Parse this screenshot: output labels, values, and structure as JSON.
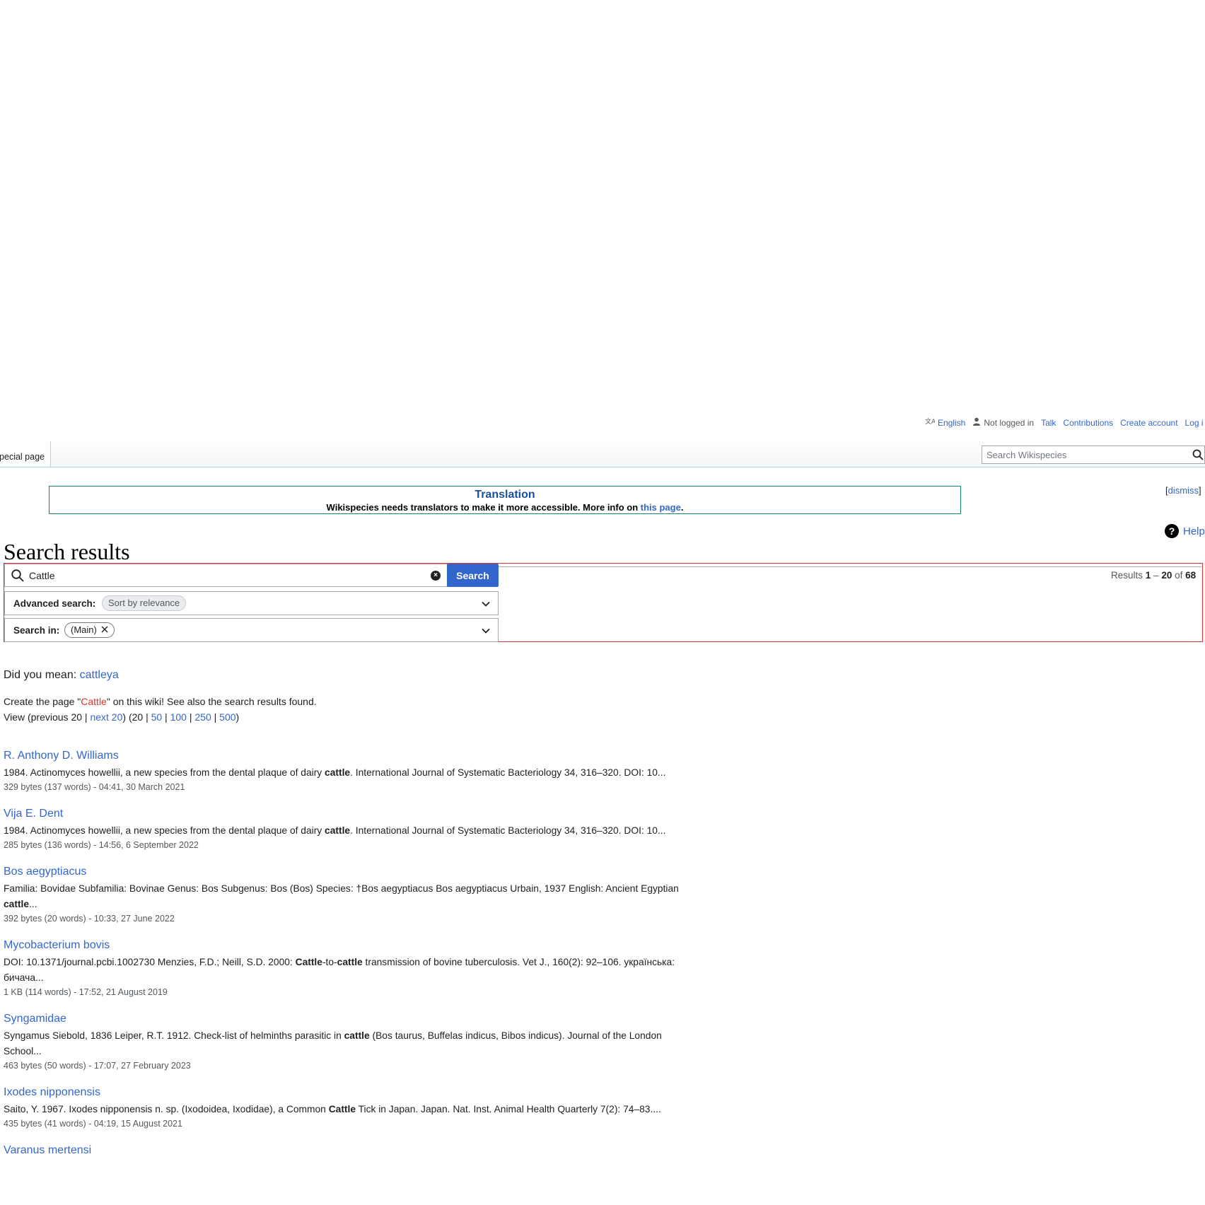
{
  "personal": {
    "language": "English",
    "not_logged_in": "Not logged in",
    "talk": "Talk",
    "contributions": "Contributions",
    "create_account": "Create account",
    "log_in": "Log i"
  },
  "tabs": {
    "special_page": "pecial page"
  },
  "header_search": {
    "placeholder": "Search Wikispecies"
  },
  "banner": {
    "title": "Translation",
    "text_prefix": "Wikispecies needs translators to make it more accessible. More info on ",
    "link": "this page",
    "text_suffix": "."
  },
  "dismiss": {
    "open": "[",
    "label": "dismiss",
    "close": "]"
  },
  "page": {
    "title": "Search results",
    "help": "Help"
  },
  "search_form": {
    "value": "Cattle",
    "button": "Search",
    "results_prefix": "Results ",
    "results_range_start": "1",
    "results_dash": " – ",
    "results_range_end": "20",
    "results_of": " of ",
    "results_total": "68",
    "advanced_label": "Advanced search:",
    "advanced_chip": "Sort by relevance",
    "search_in_label": "Search in:",
    "search_in_chip": "(Main)"
  },
  "did_you_mean": {
    "prefix": "Did you mean: ",
    "suggestion": "cattleya"
  },
  "create": {
    "prefix": "Create the page \"",
    "page": "Cattle",
    "suffix": "\" on this wiki! See also the search results found."
  },
  "view": {
    "prefix": "View (previous 20 | ",
    "next": "next 20",
    "mid": ") (20 | ",
    "n50": "50",
    "n100": "100",
    "n250": "250",
    "n500": "500",
    "sep": " | ",
    "end": ")"
  },
  "results": [
    {
      "title": "R. Anthony D. Williams",
      "snippet_before": "1984. Actinomyces howellii, a new species from the dental plaque of dairy ",
      "snippet_bold": "cattle",
      "snippet_after": ". International Journal of Systematic Bacteriology 34, 316–320. DOI: 10...",
      "meta": "329 bytes (137 words) - 04:41, 30 March 2021"
    },
    {
      "title": "Vija E. Dent",
      "snippet_before": "1984. Actinomyces howellii, a new species from the dental plaque of dairy ",
      "snippet_bold": "cattle",
      "snippet_after": ". International Journal of Systematic Bacteriology 34, 316–320. DOI: 10...",
      "meta": "285 bytes (136 words) - 14:56, 6 September 2022"
    },
    {
      "title": "Bos aegyptiacus",
      "snippet_before": "Familia: Bovidae Subfamilia: Bovinae Genus: Bos Subgenus: Bos (Bos) Species: †Bos aegyptiacus Bos aegyptiacus Urbain, 1937 English: Ancient Egyptian ",
      "snippet_bold": "cattle",
      "snippet_after": "...",
      "meta": "392 bytes (20 words) - 10:33, 27 June 2022"
    },
    {
      "title": "Mycobacterium bovis",
      "snippet_before": "DOI: 10.1371/journal.pcbi.1002730 Menzies, F.D.; Neill, S.D. 2000: ",
      "snippet_bold": "Cattle",
      "snippet_mid": "-to-",
      "snippet_bold2": "cattle",
      "snippet_after": " transmission of bovine tuberculosis. Vet J., 160(2): 92–106. українська: бичача...",
      "meta": "1 KB (114 words) - 17:52, 21 August 2019"
    },
    {
      "title": "Syngamidae",
      "snippet_before": "Syngamus Siebold, 1836 Leiper, R.T. 1912. Check-list of helminths parasitic in ",
      "snippet_bold": "cattle",
      "snippet_after": " (Bos taurus, Buffelas indicus, Bibos indicus). Journal of the London School...",
      "meta": "463 bytes (50 words) - 17:07, 27 February 2023"
    },
    {
      "title": "Ixodes nipponensis",
      "snippet_before": "Saito, Y. 1967. Ixodes nipponensis n. sp. (Ixodoidea, Ixodidae), a Common ",
      "snippet_bold": "Cattle",
      "snippet_after": " Tick in Japan. Japan. Nat. Inst. Animal Health Quarterly 7(2): 74–83....",
      "meta": "435 bytes (41 words) - 04:19, 15 August 2021"
    },
    {
      "title": "Varanus mertensi",
      "snippet_before": "",
      "snippet_bold": "",
      "snippet_after": "",
      "meta": ""
    }
  ]
}
